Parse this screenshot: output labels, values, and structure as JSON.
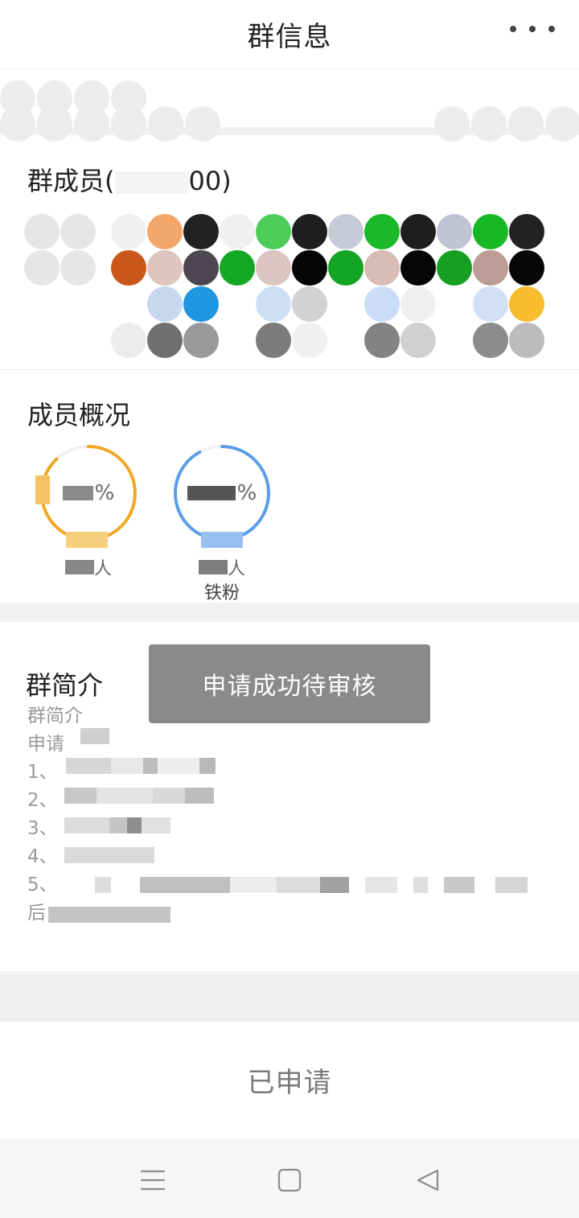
{
  "header": {
    "title": "群信息"
  },
  "members": {
    "title": "群成员(",
    "title_tail": "00)",
    "avatar_colors": [
      "#f0f0f0",
      "#f2a66a",
      "#222222",
      "#f0f0f0",
      "#4ccd5a",
      "#1f1f1f",
      "#c8cad8",
      "#1bb92a",
      "#1e1e1e",
      "#c0c4d4",
      "#17b825",
      "#222222",
      "#c9561a",
      "#e0c4be",
      "#4b4650",
      "#13a824",
      "#dcc4c0",
      "#050505",
      "#13a424",
      "#d8bdb4",
      "#060606",
      "#15a022",
      "#bc9c96",
      "#070707",
      "#ffffff",
      "#c7d7ee",
      "#1e96e0",
      "#ffffff",
      "#cfdff5",
      "#d2d2d2",
      "#ffffff",
      "#cadcf7",
      "#f0f0f0",
      "#ffffff",
      "#d2e0f6",
      "#f8bc2e",
      "#ececec",
      "#707070",
      "#9a9a9a",
      "#ffffff",
      "#7c7c7c",
      "#f0f0f0",
      "#ffffff",
      "#838383",
      "#d0d0d0",
      "#ffffff",
      "#8c8c8c",
      "#bcbcbc"
    ]
  },
  "overview": {
    "title": "成员概况",
    "rings": [
      {
        "pct_text": "%",
        "value": 0.88,
        "color": "#f0a826",
        "count_text": "人",
        "label": ""
      },
      {
        "pct_text": "%",
        "value": 0.92,
        "color": "#5b9de8",
        "count_text": "人",
        "label": "铁粉"
      }
    ]
  },
  "intro": {
    "title": "群简介",
    "lines": [
      "群简介",
      "申请",
      "1、",
      "2、",
      "3、",
      "4、",
      "5、",
      "后"
    ]
  },
  "toast": {
    "text": "申请成功待审核"
  },
  "actions": {
    "applied_label": "已申请"
  },
  "navbar": {
    "icons": [
      "menu-icon",
      "home-square-icon",
      "back-triangle-icon"
    ]
  }
}
